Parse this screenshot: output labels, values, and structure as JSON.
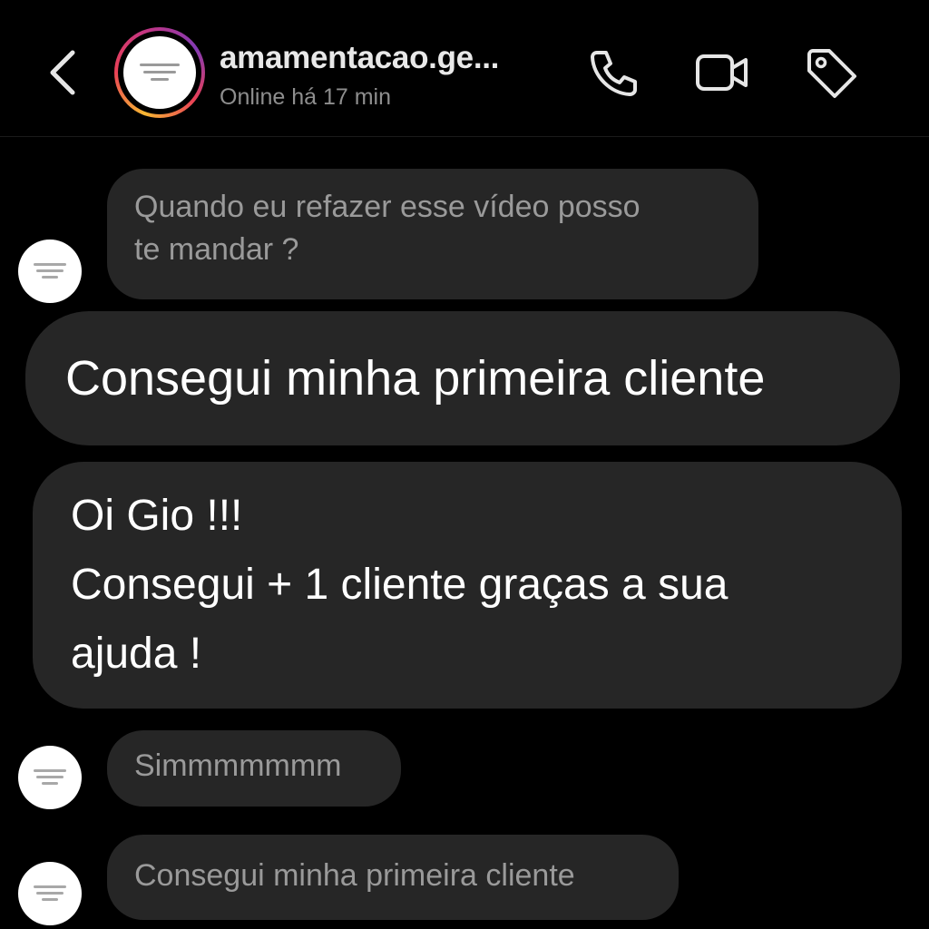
{
  "header": {
    "contact_name": "amamentacao.ge...",
    "status": "Online há 17 min",
    "icons": {
      "back": "chevron-left-icon",
      "call": "phone-icon",
      "video": "video-camera-icon",
      "tag": "tag-icon"
    },
    "story_ring_colors": [
      "#f7b733",
      "#e94057",
      "#c13584",
      "#833ab4"
    ]
  },
  "messages": [
    {
      "direction": "incoming",
      "lines": [
        "Quando eu refazer esse vídeo posso",
        "te mandar ?"
      ]
    },
    {
      "direction": "overlay",
      "lines": [
        "Consegui minha primeira cliente"
      ]
    },
    {
      "direction": "overlay",
      "lines": [
        "Oi Gio !!!",
        "Consegui + 1 cliente graças a sua",
        "ajuda !"
      ]
    },
    {
      "direction": "incoming",
      "lines": [
        "Simmmmmmm"
      ]
    },
    {
      "direction": "incoming",
      "lines": [
        "Consegui minha primeira cliente"
      ]
    }
  ],
  "colors": {
    "background": "#000000",
    "bubble": "#262626",
    "incoming_text": "#9a9a9a",
    "highlight_text": "#ffffff",
    "status_text": "#8e8e8e"
  }
}
